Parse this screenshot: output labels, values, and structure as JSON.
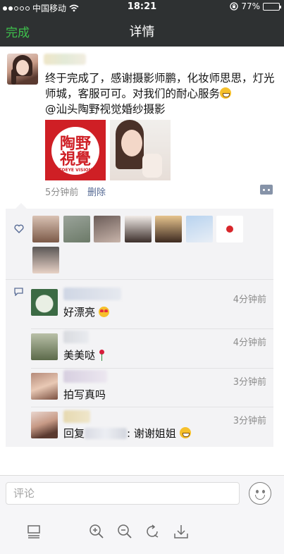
{
  "status_bar": {
    "carrier": "中国移动",
    "time": "18:21",
    "battery": "77%",
    "battery_level": 0.77,
    "icons": [
      "signal-icon",
      "wifi-icon",
      "rotation-lock-icon",
      "battery-icon"
    ]
  },
  "nav": {
    "done_label": "完成",
    "title": "详情"
  },
  "post": {
    "text": "终于完成了，感谢摄影师鹏，化妆师思思，灯光师城，客服可可。对我们的耐心服务",
    "text_tail": "@汕头陶野视觉婚纱摄影",
    "logo_line1": "陶野",
    "logo_line2": "視覺",
    "logo_sub": "TOEYE VISION",
    "time": "5分钟前",
    "delete_label": "删除"
  },
  "likes": {
    "icon": "heart-outline-icon",
    "count": 8
  },
  "comments": [
    {
      "time": "4分钟前",
      "text": "好漂亮"
    },
    {
      "time": "4分钟前",
      "text": "美美哒"
    },
    {
      "time": "3分钟前",
      "text": "拍写真吗"
    },
    {
      "time": "3分钟前",
      "reply_prefix": "回复",
      "reply_text": ": 谢谢姐姐"
    }
  ],
  "input": {
    "placeholder": "评论"
  },
  "toolbar": {
    "icons": [
      "layout-icon",
      "zoom-in-icon",
      "zoom-out-icon",
      "rotate-icon",
      "download-icon"
    ]
  },
  "colors": {
    "nav_bg": "#2e3132",
    "done_green": "#3ec14c",
    "link_blue": "#576b95",
    "feedback_bg": "#f3f3f5"
  }
}
